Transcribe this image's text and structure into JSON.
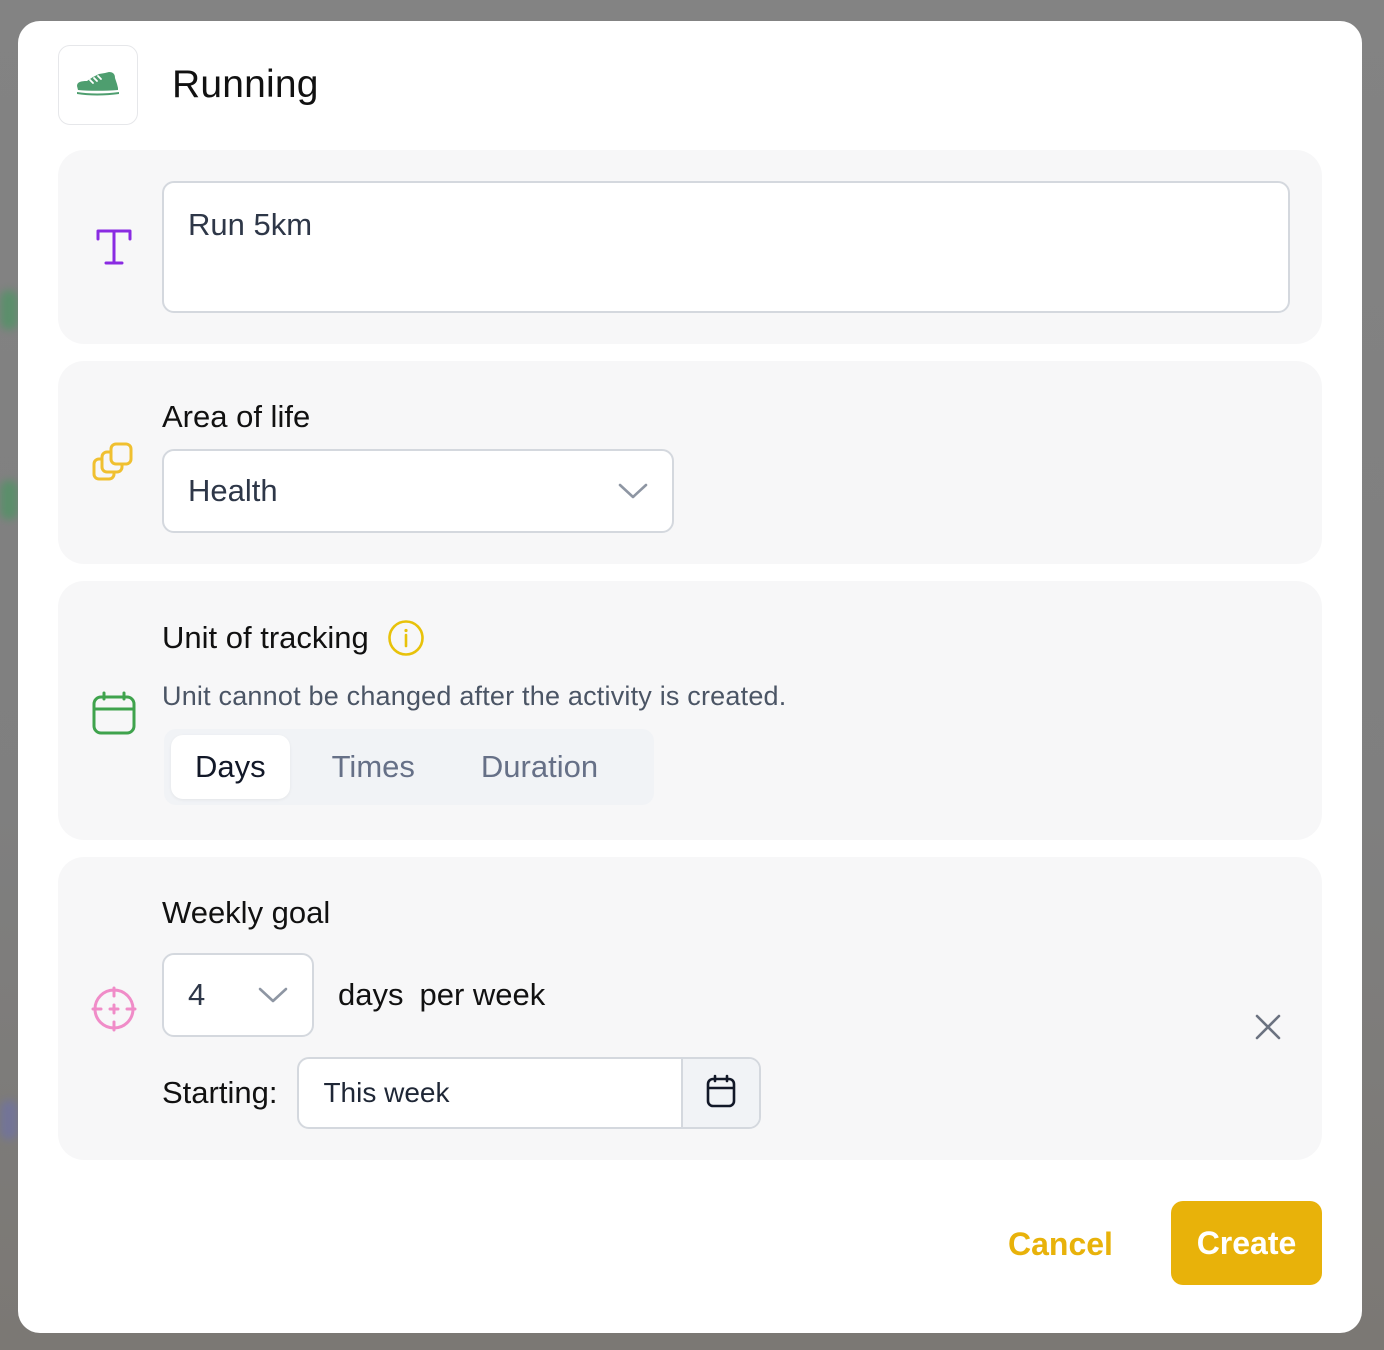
{
  "colors": {
    "accent": "#e8b20a",
    "shoe_icon": "#4e9e6f",
    "text_icon": "#8a2be2",
    "area_icon": "#f0c030",
    "unit_icon": "#3fa34d",
    "goal_icon": "#f08cc8",
    "info_icon": "#e8c20a"
  },
  "header": {
    "icon": "running-shoe-icon",
    "title": "Running"
  },
  "name_field": {
    "icon": "text-t-icon",
    "value": "Run 5km"
  },
  "area_of_life": {
    "icon": "stacked-squares-icon",
    "label": "Area of life",
    "selected": "Health"
  },
  "unit_of_tracking": {
    "icon": "calendar-icon",
    "label": "Unit of tracking",
    "info_icon": "info-circle-icon",
    "hint": "Unit cannot be changed after the activity is created.",
    "options": [
      "Days",
      "Times",
      "Duration"
    ],
    "selected": "Days"
  },
  "weekly_goal": {
    "icon": "crosshair-target-icon",
    "label": "Weekly goal",
    "count": "4",
    "unit_text": "days",
    "period_text": "per week",
    "starting_label": "Starting:",
    "starting_value": "This week",
    "calendar_icon": "calendar-icon",
    "remove_icon": "close-x-icon"
  },
  "footer": {
    "cancel_label": "Cancel",
    "create_label": "Create"
  }
}
